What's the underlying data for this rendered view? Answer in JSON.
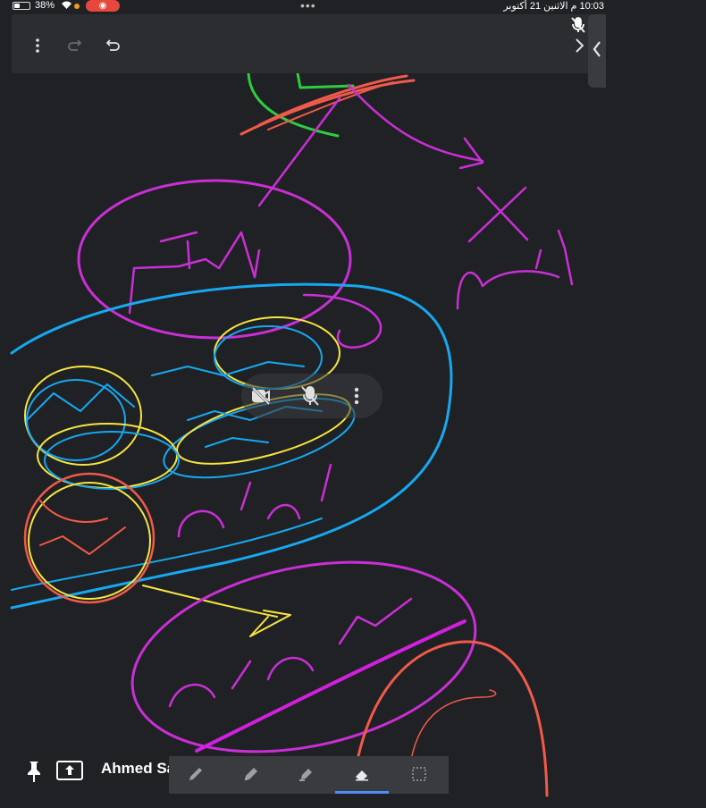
{
  "status_bar": {
    "battery_percent": "38%",
    "battery_level": 0.38,
    "time_date": "10:03 م   الاثنين 21 أكتوبر",
    "record_indicator": "◉",
    "recording_color": "#e8473d",
    "camera_dot_color": "#f39c12"
  },
  "toolbar": {
    "more_icon": "more-vertical-icon",
    "redo_icon": "redo-icon",
    "undo_icon": "undo-icon",
    "next_icon": "chevron-right-icon",
    "collapse_icon": "chevron-left-icon",
    "mic_state": "muted"
  },
  "floating_controls": {
    "camera_state": "off",
    "mic_state": "muted"
  },
  "participant": {
    "name": "Ahmed Saad"
  },
  "tools": [
    {
      "name": "pen",
      "selected": false
    },
    {
      "name": "marker",
      "selected": false
    },
    {
      "name": "highlighter",
      "selected": false
    },
    {
      "name": "eraser",
      "selected": true
    },
    {
      "name": "select",
      "selected": false
    }
  ],
  "colors": {
    "canvas_bg": "#202124",
    "toolbar_bg": "#2c2d30",
    "accent": "#4f8cf7"
  }
}
